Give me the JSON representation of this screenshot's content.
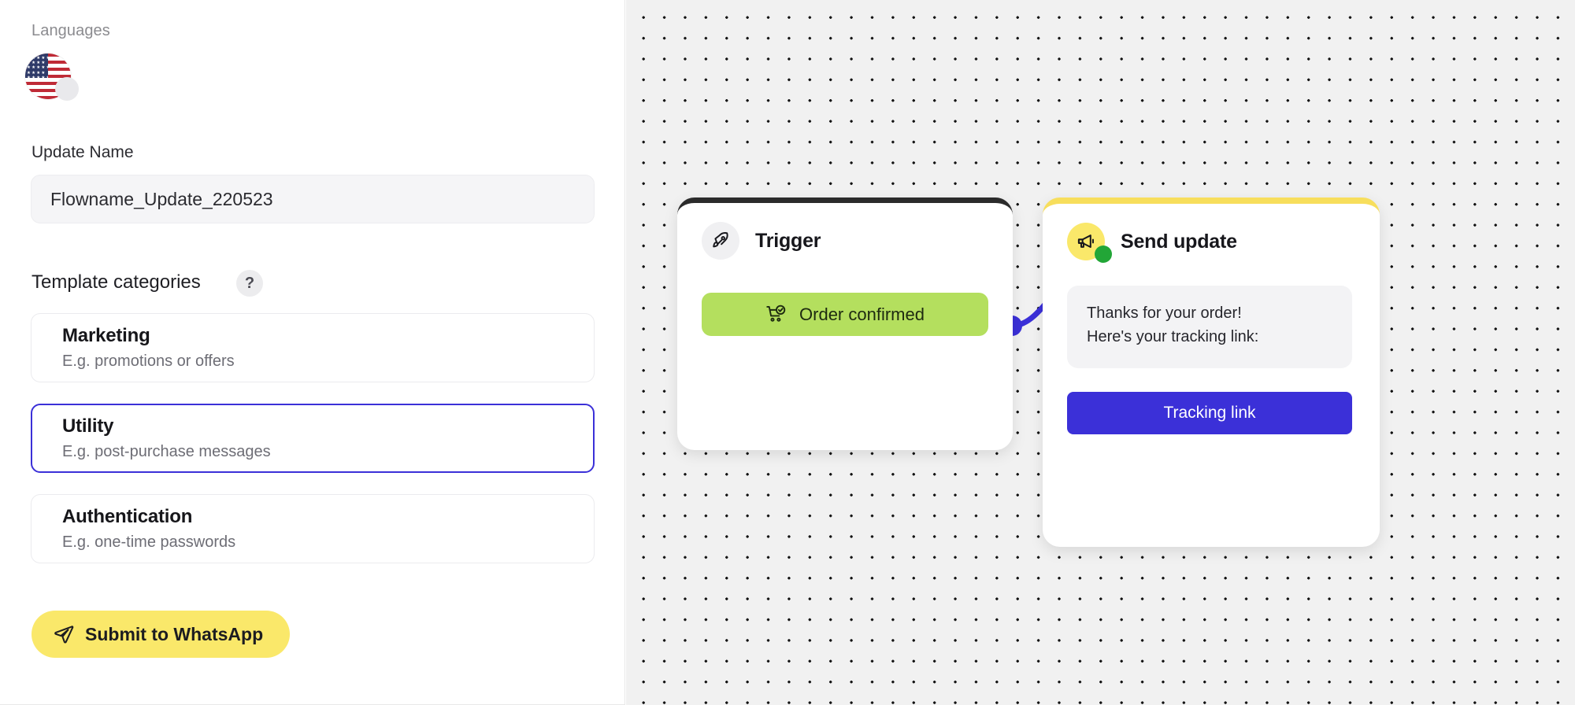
{
  "left_panel": {
    "languages_label": "Languages",
    "language_flag": "us-flag-icon",
    "add_language_icon": "add-language-circle-icon",
    "update_name_label": "Update Name",
    "update_name_value": "Flowname_Update_220523",
    "update_name_placeholder": "Flowname_Update_220523",
    "template_categories_label": "Template categories",
    "help_icon_glyph": "?",
    "categories": [
      {
        "title": "Marketing",
        "subtitle": "E.g. promotions or offers",
        "selected": false
      },
      {
        "title": "Utility",
        "subtitle": "E.g. post-purchase messages",
        "selected": true
      },
      {
        "title": "Authentication",
        "subtitle": "E.g. one-time passwords",
        "selected": false
      }
    ],
    "submit_button": {
      "label": "Submit to WhatsApp",
      "icon": "send-plane-icon",
      "background": "#fae86a"
    }
  },
  "canvas": {
    "background": "#f1f1f1",
    "dot_color": "#111111",
    "edge_color": "#3b30d8",
    "nodes": [
      {
        "id": "trigger",
        "title": "Trigger",
        "icon": "rocket-icon",
        "accent": "#2b2b2b",
        "action_label": "Order confirmed",
        "action_icon": "cart-check-icon",
        "action_color": "#b4df5e"
      },
      {
        "id": "send-update",
        "title": "Send update",
        "icon": "megaphone-icon",
        "accent": "#f7de5c",
        "status_dot_color": "#22a637",
        "message_lines": [
          "Thanks for your order!",
          "Here's your tracking link:"
        ],
        "cta_label": "Tracking link",
        "cta_color": "#3b30d8"
      }
    ]
  }
}
